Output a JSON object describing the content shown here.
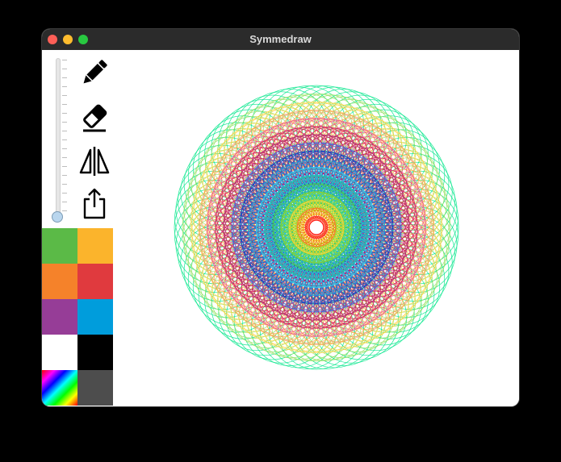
{
  "window": {
    "title": "Symmedraw"
  },
  "brush_size": {
    "level": 0.0
  },
  "tools": [
    {
      "name": "pencil-icon"
    },
    {
      "name": "eraser-icon"
    },
    {
      "name": "mirror-symmetry-icon"
    },
    {
      "name": "share-icon"
    }
  ],
  "swatches": [
    {
      "color": "#5bba47"
    },
    {
      "color": "#fbb42c"
    },
    {
      "color": "#f5822a"
    },
    {
      "color": "#e03a3e"
    },
    {
      "color": "#963d97"
    },
    {
      "color": "#009ddc"
    },
    {
      "color": "#ffffff"
    },
    {
      "color": "#000000"
    },
    {
      "color": "rainbow"
    },
    {
      "color": "#4d4d4d"
    }
  ],
  "drawing": {
    "rings": [
      {
        "color": "#00e68a"
      },
      {
        "color": "#8fe05a"
      },
      {
        "color": "#ffd23a"
      },
      {
        "color": "#f59a55"
      },
      {
        "color": "#ef4f86"
      },
      {
        "color": "#d6135a"
      },
      {
        "color": "#b31e6a"
      },
      {
        "color": "#3f66d9"
      },
      {
        "color": "#0a47c6"
      },
      {
        "color": "#1b99e0"
      },
      {
        "color": "#29cde8"
      },
      {
        "color": "#1ec9a9"
      },
      {
        "color": "#3cd34a"
      },
      {
        "color": "#9ad81f"
      },
      {
        "color": "#f4d21a"
      },
      {
        "color": "#f06a1a"
      },
      {
        "color": "#ff2a20"
      }
    ]
  }
}
